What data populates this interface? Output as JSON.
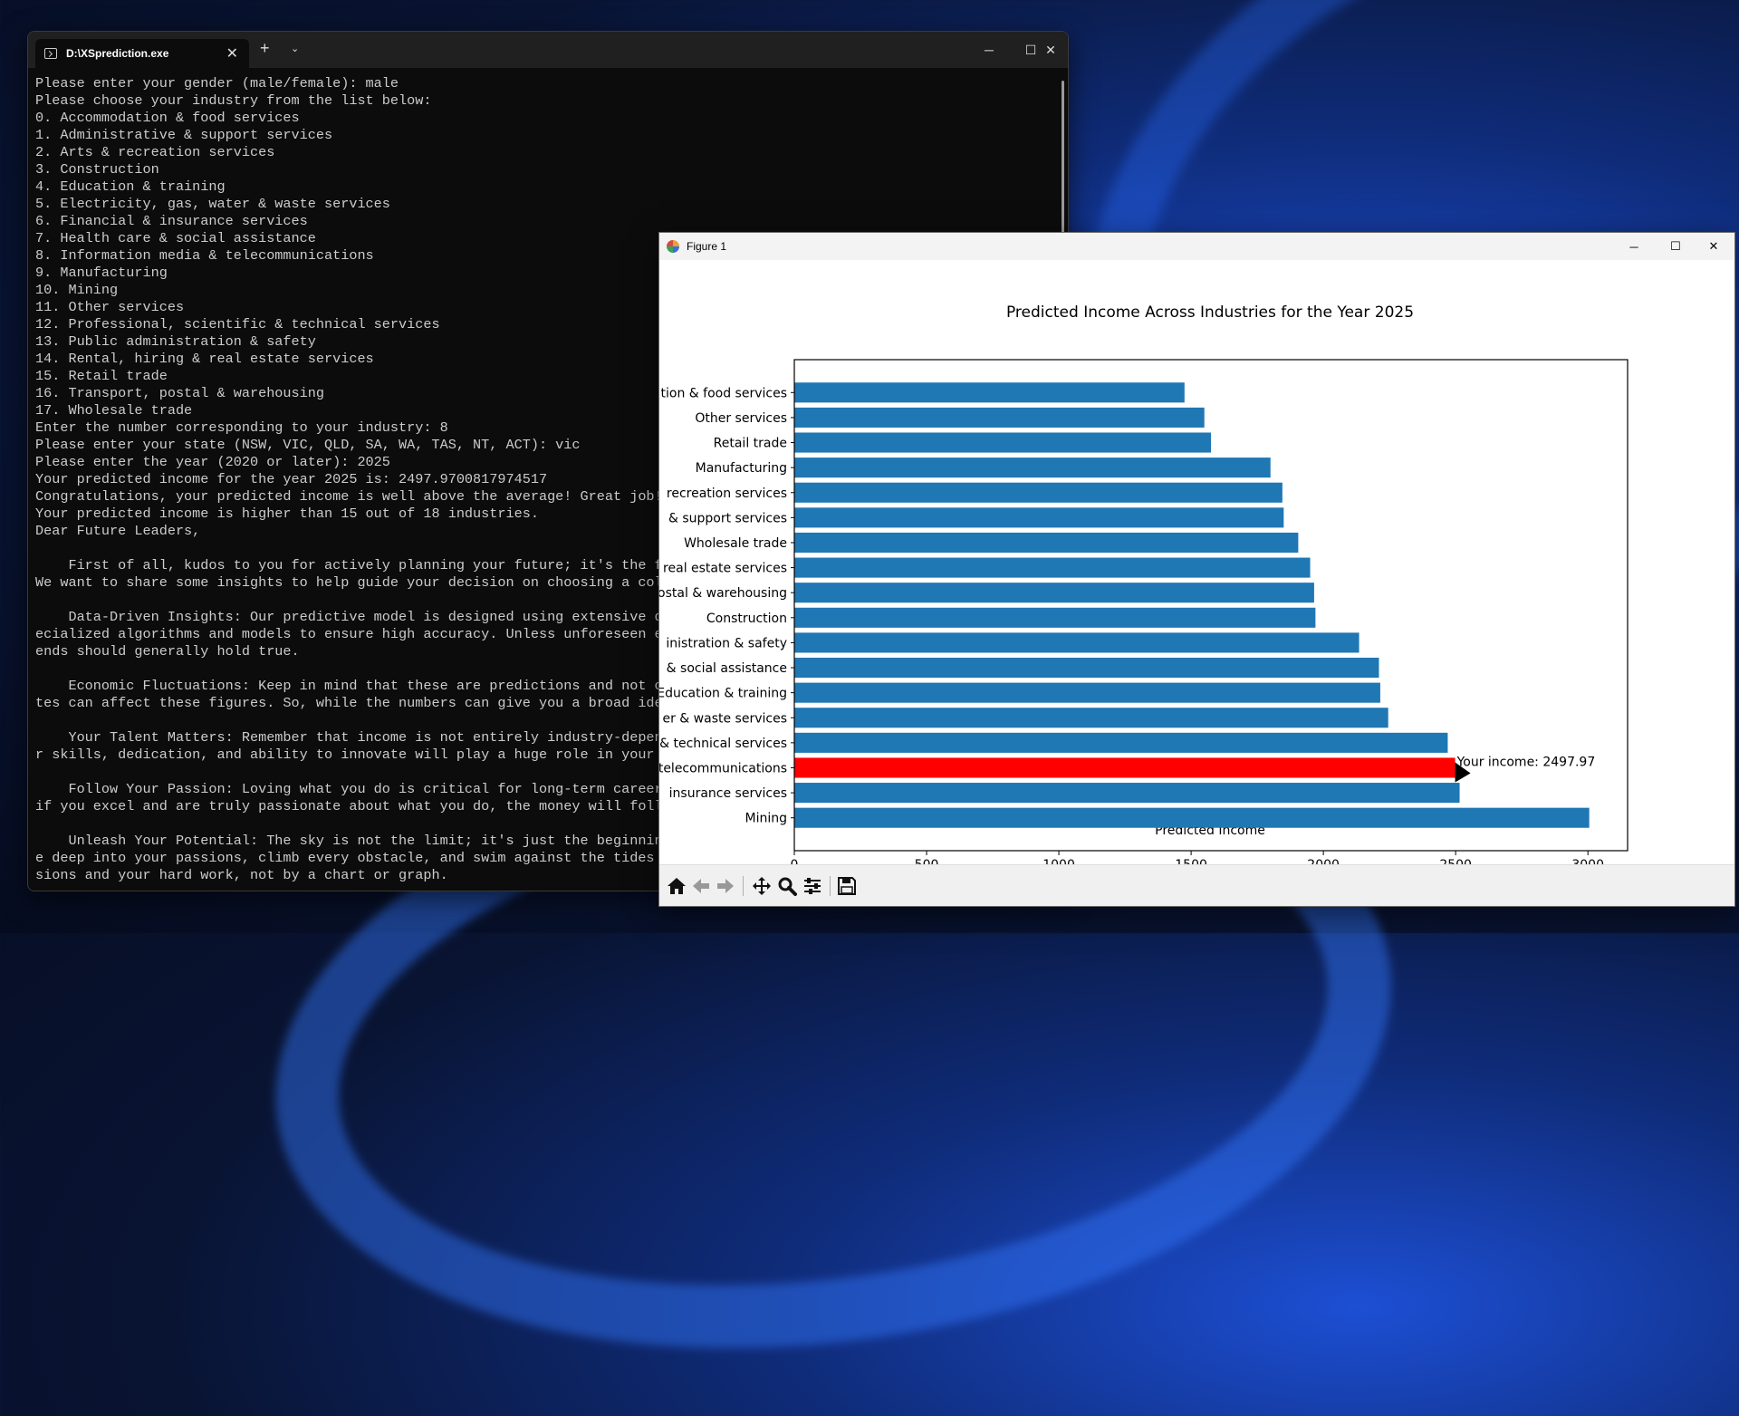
{
  "terminal": {
    "tab_title": "D:\\XSprediction.exe",
    "new_tab_symbol": "+",
    "dropdown_symbol": "⌄",
    "close_symbol": "✕",
    "minimize_symbol": "─",
    "maximize_symbol": "☐",
    "lines": [
      "Please enter your gender (male/female): male",
      "Please choose your industry from the list below:",
      "0. Accommodation & food services",
      "1. Administrative & support services",
      "2. Arts & recreation services",
      "3. Construction",
      "4. Education & training",
      "5. Electricity, gas, water & waste services",
      "6. Financial & insurance services",
      "7. Health care & social assistance",
      "8. Information media & telecommunications",
      "9. Manufacturing",
      "10. Mining",
      "11. Other services",
      "12. Professional, scientific & technical services",
      "13. Public administration & safety",
      "14. Rental, hiring & real estate services",
      "15. Retail trade",
      "16. Transport, postal & warehousing",
      "17. Wholesale trade",
      "Enter the number corresponding to your industry: 8",
      "Please enter your state (NSW, VIC, QLD, SA, WA, TAS, NT, ACT): vic",
      "Please enter the year (2020 or later): 2025",
      "Your predicted income for the year 2025 is: 2497.9700817974517",
      "Congratulations, your predicted income is well above the average! Great job!",
      "Your predicted income is higher than 15 out of 18 industries.",
      "Dear Future Leaders,",
      "",
      "    First of all, kudos to you for actively planning your future; it's the fi",
      "We want to share some insights to help guide your decision on choosing a coll",
      "",
      "    Data-Driven Insights: Our predictive model is designed using extensive da",
      "ecialized algorithms and models to ensure high accuracy. Unless unforeseen ev",
      "ends should generally hold true.",
      "",
      "    Economic Fluctuations: Keep in mind that these are predictions and not ce",
      "tes can affect these figures. So, while the numbers can give you a broad ide",
      "",
      "    Your Talent Matters: Remember that income is not entirely industry-depend",
      "r skills, dedication, and ability to innovate will play a huge role in your &",
      "",
      "    Follow Your Passion: Loving what you do is critical for long-term career",
      "if you excel and are truly passionate about what you do, the money will follo",
      "",
      "    Unleash Your Potential: The sky is not the limit; it's just the beginning",
      "e deep into your passions, climb every obstacle, and swim against the tides i",
      "sions and your hard work, not by a chart or graph."
    ]
  },
  "figure": {
    "window_title": "Figure 1",
    "minimize_symbol": "─",
    "maximize_symbol": "☐",
    "close_symbol": "✕",
    "toolbar": {
      "home": "home-icon",
      "back": "back-arrow-icon",
      "forward": "forward-arrow-icon",
      "pan": "pan-icon",
      "zoom": "zoom-icon",
      "configure": "configure-subplots-icon",
      "save": "save-icon"
    }
  },
  "chart_data": {
    "type": "bar",
    "orientation": "horizontal",
    "title": "Predicted Income Across Industries for the Year 2025",
    "xlabel": "Predicted Income",
    "ylabel": "",
    "xlim": [
      0,
      3150
    ],
    "xticks": [
      0,
      500,
      1000,
      1500,
      2000,
      2500,
      3000
    ],
    "grid": false,
    "bar_color": "#1f77b4",
    "highlight_color": "#ff0000",
    "categories": [
      "Accommodation & food services",
      "Other services",
      "Retail trade",
      "Manufacturing",
      "Arts & recreation services",
      "Administrative & support services",
      "Wholesale trade",
      "Rental, hiring & real estate services",
      "Transport, postal & warehousing",
      "Construction",
      "Public administration & safety",
      "Health care & social assistance",
      "Education & training",
      "Electricity, gas, water & waste services",
      "Professional, scientific & technical services",
      "Information media & telecommunications",
      "Financial & insurance services",
      "Mining"
    ],
    "visible_labels": [
      "tion & food services",
      "Other services",
      "Retail trade",
      "Manufacturing",
      "recreation services",
      "& support services",
      "Wholesale trade",
      "real estate services",
      "ostal & warehousing",
      "Construction",
      "inistration & safety",
      "& social assistance",
      "Education & training",
      "er & waste services",
      "& technical services",
      "telecommunications",
      "insurance services",
      "Mining"
    ],
    "values": [
      1475,
      1550,
      1575,
      1800,
      1845,
      1850,
      1905,
      1950,
      1965,
      1970,
      2135,
      2210,
      2215,
      2245,
      2470,
      2498,
      2515,
      3005
    ],
    "highlight_index": 15,
    "annotation": {
      "text": "Your income: 2497.97",
      "x": 2497.97
    }
  }
}
